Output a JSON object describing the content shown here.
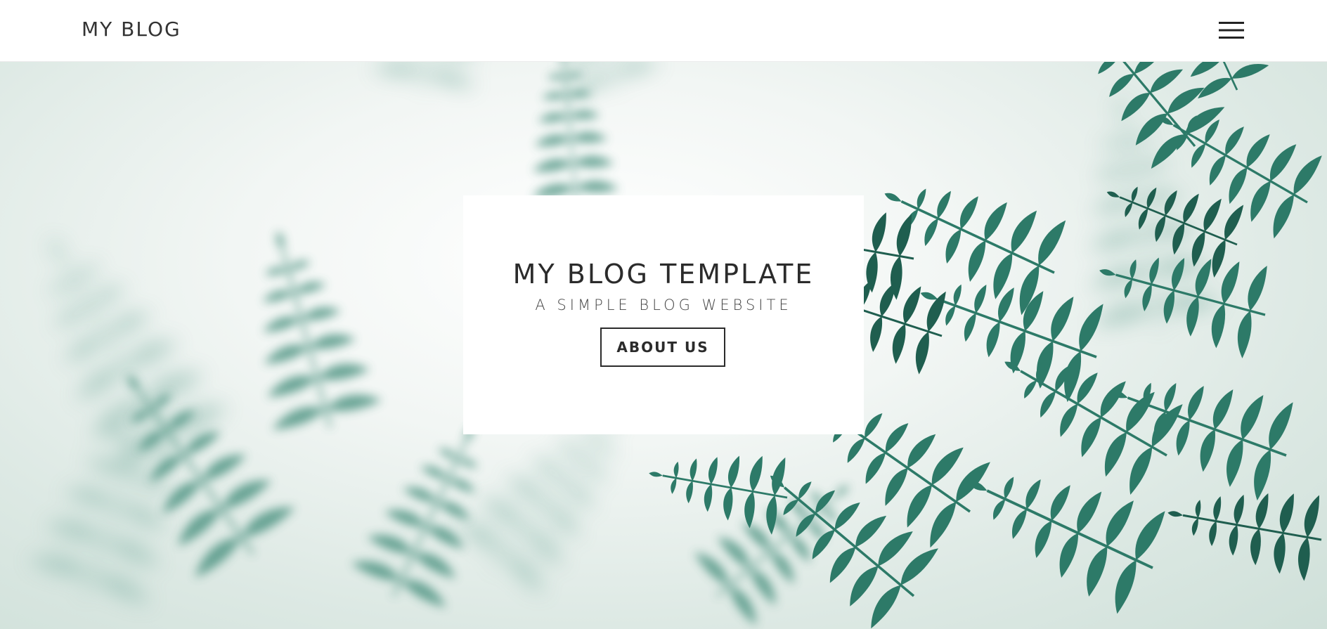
{
  "header": {
    "brand": "MY BLOG",
    "menu_icon": "hamburger-menu-icon"
  },
  "hero": {
    "background_image": "fern-leaves-in-mist",
    "card": {
      "title": "MY BLOG TEMPLATE",
      "subtitle": "A SIMPLE BLOG WEBSITE",
      "button_label": "ABOUT US"
    }
  },
  "colors": {
    "text_dark": "#2b2b2b",
    "background": "#ffffff",
    "fern_dark": "#1f5e4f",
    "fern_mid": "#2d7a68",
    "fern_light": "#8fb8ad"
  }
}
